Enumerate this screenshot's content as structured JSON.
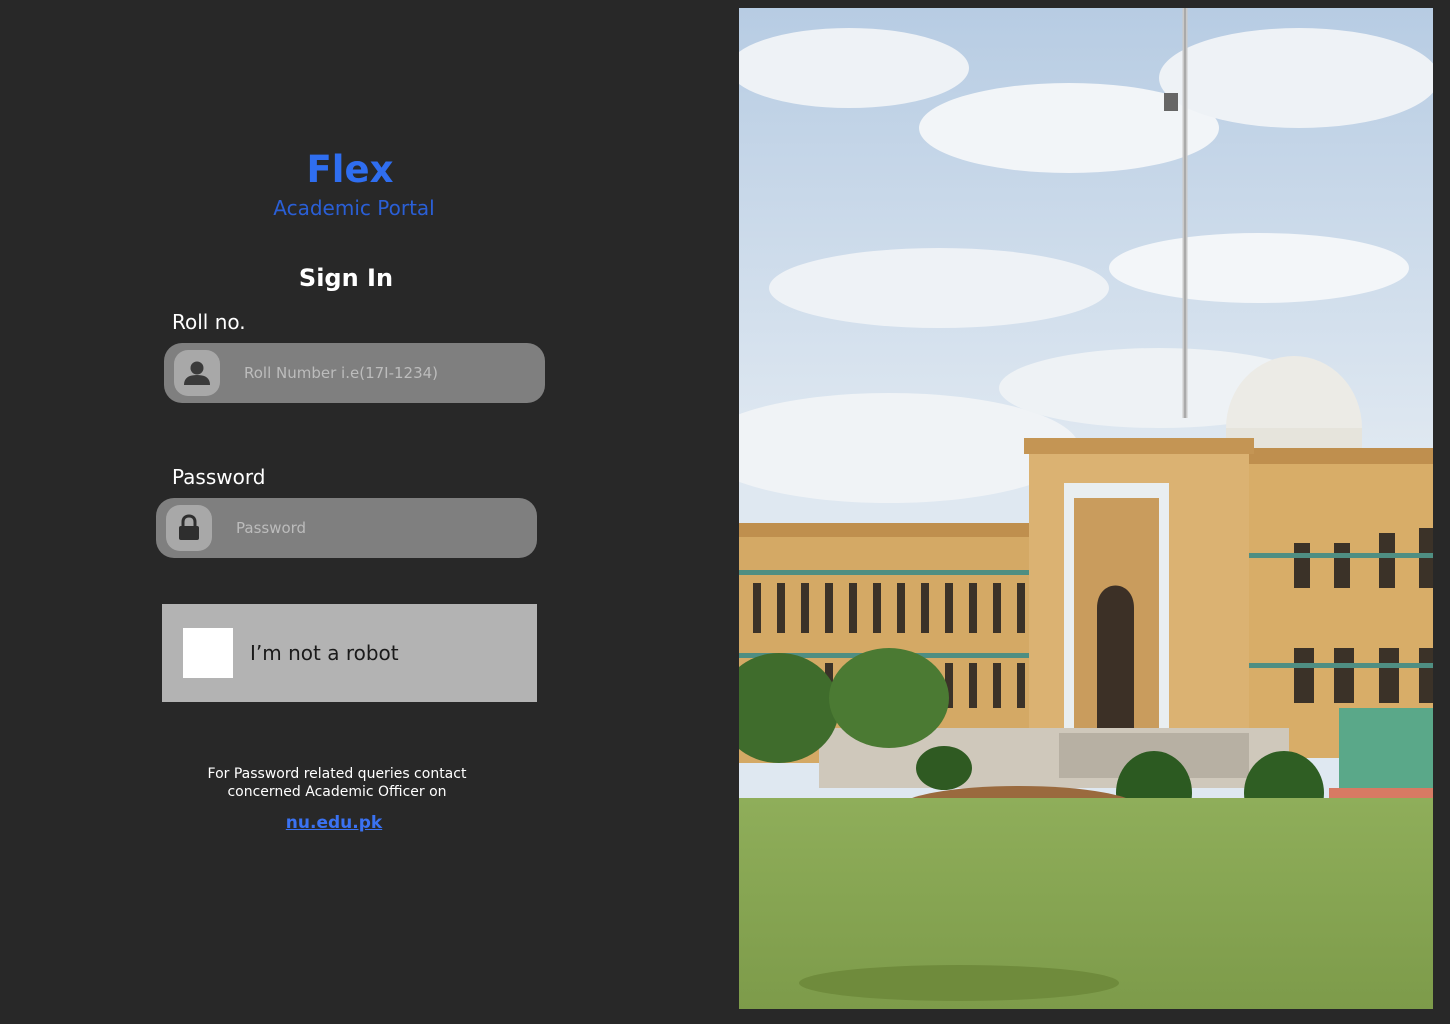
{
  "brand": {
    "title": "Flex",
    "subtitle": "Academic Portal"
  },
  "form": {
    "heading": "Sign In",
    "roll": {
      "label": "Roll no.",
      "placeholder": "Roll Number i.e(17I-1234)",
      "icon": "user-icon"
    },
    "password": {
      "label": "Password",
      "placeholder": "Password",
      "icon": "lock-icon"
    },
    "captcha": {
      "label": "I’m not a robot"
    }
  },
  "help": {
    "text": "For Password related queries contact concerned Academic Officer on",
    "link": "nu.edu.pk"
  },
  "colors": {
    "background": "#282828",
    "accent": "#2f6ef0",
    "input_bg": "#7f7f7f",
    "captcha_bg": "#b3b3b3"
  }
}
